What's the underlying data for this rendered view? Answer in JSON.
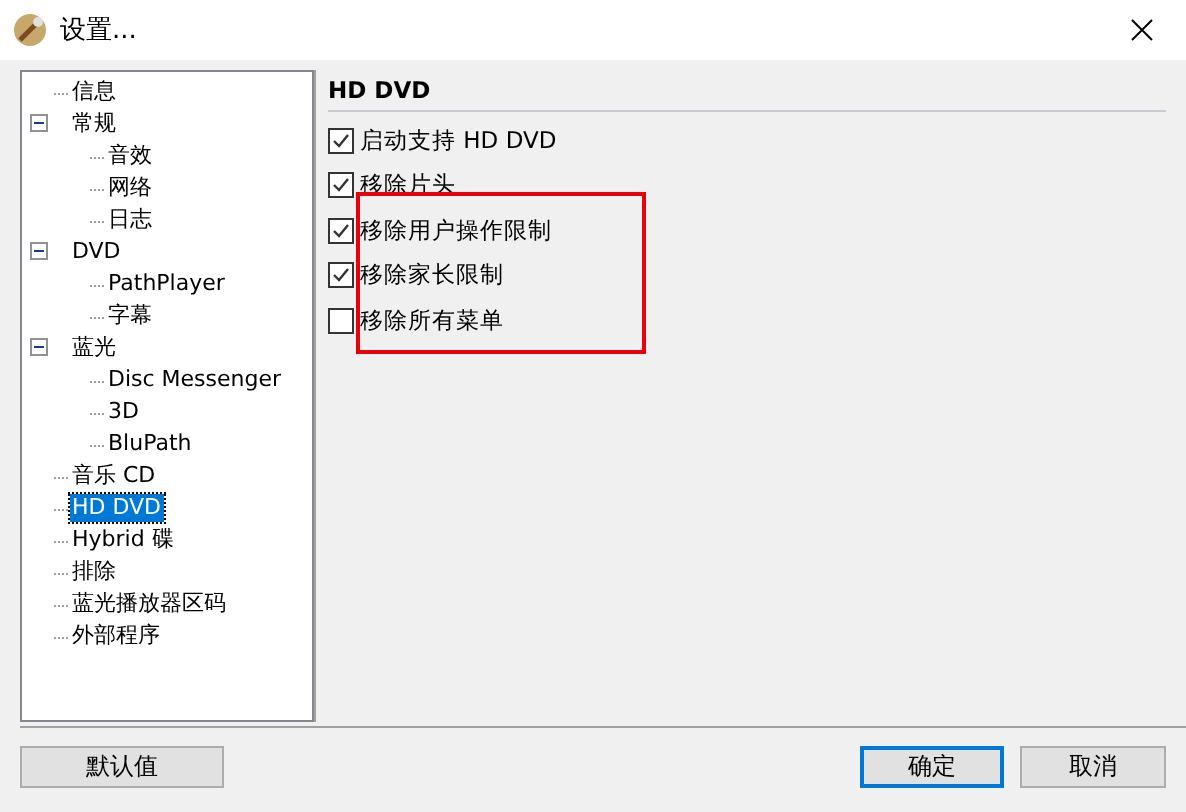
{
  "window": {
    "title": "设置..."
  },
  "tree": [
    {
      "label": "信息",
      "selected": false
    },
    {
      "label": "常规",
      "selected": false,
      "expanded": true,
      "children": [
        {
          "label": "音效",
          "selected": false
        },
        {
          "label": "网络",
          "selected": false
        },
        {
          "label": "日志",
          "selected": false
        }
      ]
    },
    {
      "label": "DVD",
      "selected": false,
      "expanded": true,
      "children": [
        {
          "label": "PathPlayer",
          "selected": false
        },
        {
          "label": "字幕",
          "selected": false
        }
      ]
    },
    {
      "label": "蓝光",
      "selected": false,
      "expanded": true,
      "children": [
        {
          "label": "Disc Messenger",
          "selected": false
        },
        {
          "label": "3D",
          "selected": false
        },
        {
          "label": "BluPath",
          "selected": false
        }
      ]
    },
    {
      "label": "音乐 CD",
      "selected": false
    },
    {
      "label": "HD DVD",
      "selected": true
    },
    {
      "label": "Hybrid 碟",
      "selected": false
    },
    {
      "label": "排除",
      "selected": false
    },
    {
      "label": "蓝光播放器区码",
      "selected": false
    },
    {
      "label": "外部程序",
      "selected": false
    }
  ],
  "section": {
    "title": "HD DVD",
    "options": [
      {
        "label": "启动支持 HD DVD",
        "checked": true
      },
      {
        "label": "移除片头",
        "checked": true
      },
      {
        "label": "移除用户操作限制",
        "checked": true
      },
      {
        "label": "移除家长限制",
        "checked": true
      },
      {
        "label": "移除所有菜单",
        "checked": false
      }
    ]
  },
  "buttons": {
    "defaults": "默认值",
    "ok": "确定",
    "cancel": "取消"
  }
}
